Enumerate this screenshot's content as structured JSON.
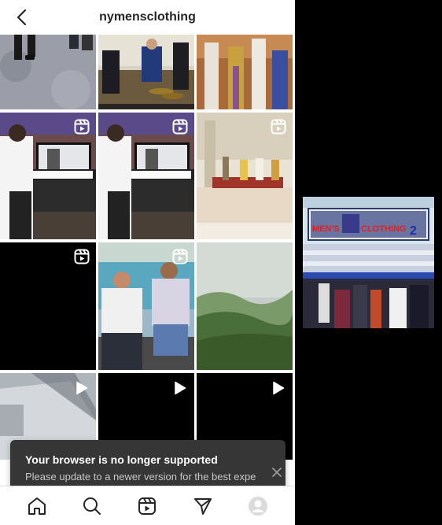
{
  "header": {
    "title": "nymensclothing"
  },
  "icons": {
    "back": "back-arrow-icon",
    "reel": "reel-icon",
    "play": "play-icon",
    "home": "home-icon",
    "search": "search-icon",
    "reels": "reels-icon",
    "direct": "direct-message-icon",
    "profile": "profile-avatar-icon",
    "close": "close-icon"
  },
  "toast": {
    "title": "Your browser is no longer supported",
    "message": "Please update to a newer version for the best expe"
  },
  "store_photo": {
    "sign_line1": "MEN'S",
    "sign_line2": "CLOTHING",
    "sign_number": "2"
  },
  "colors": {
    "toast_bg": "#363636",
    "text": "#262626",
    "divider": "#dbdbdb"
  }
}
